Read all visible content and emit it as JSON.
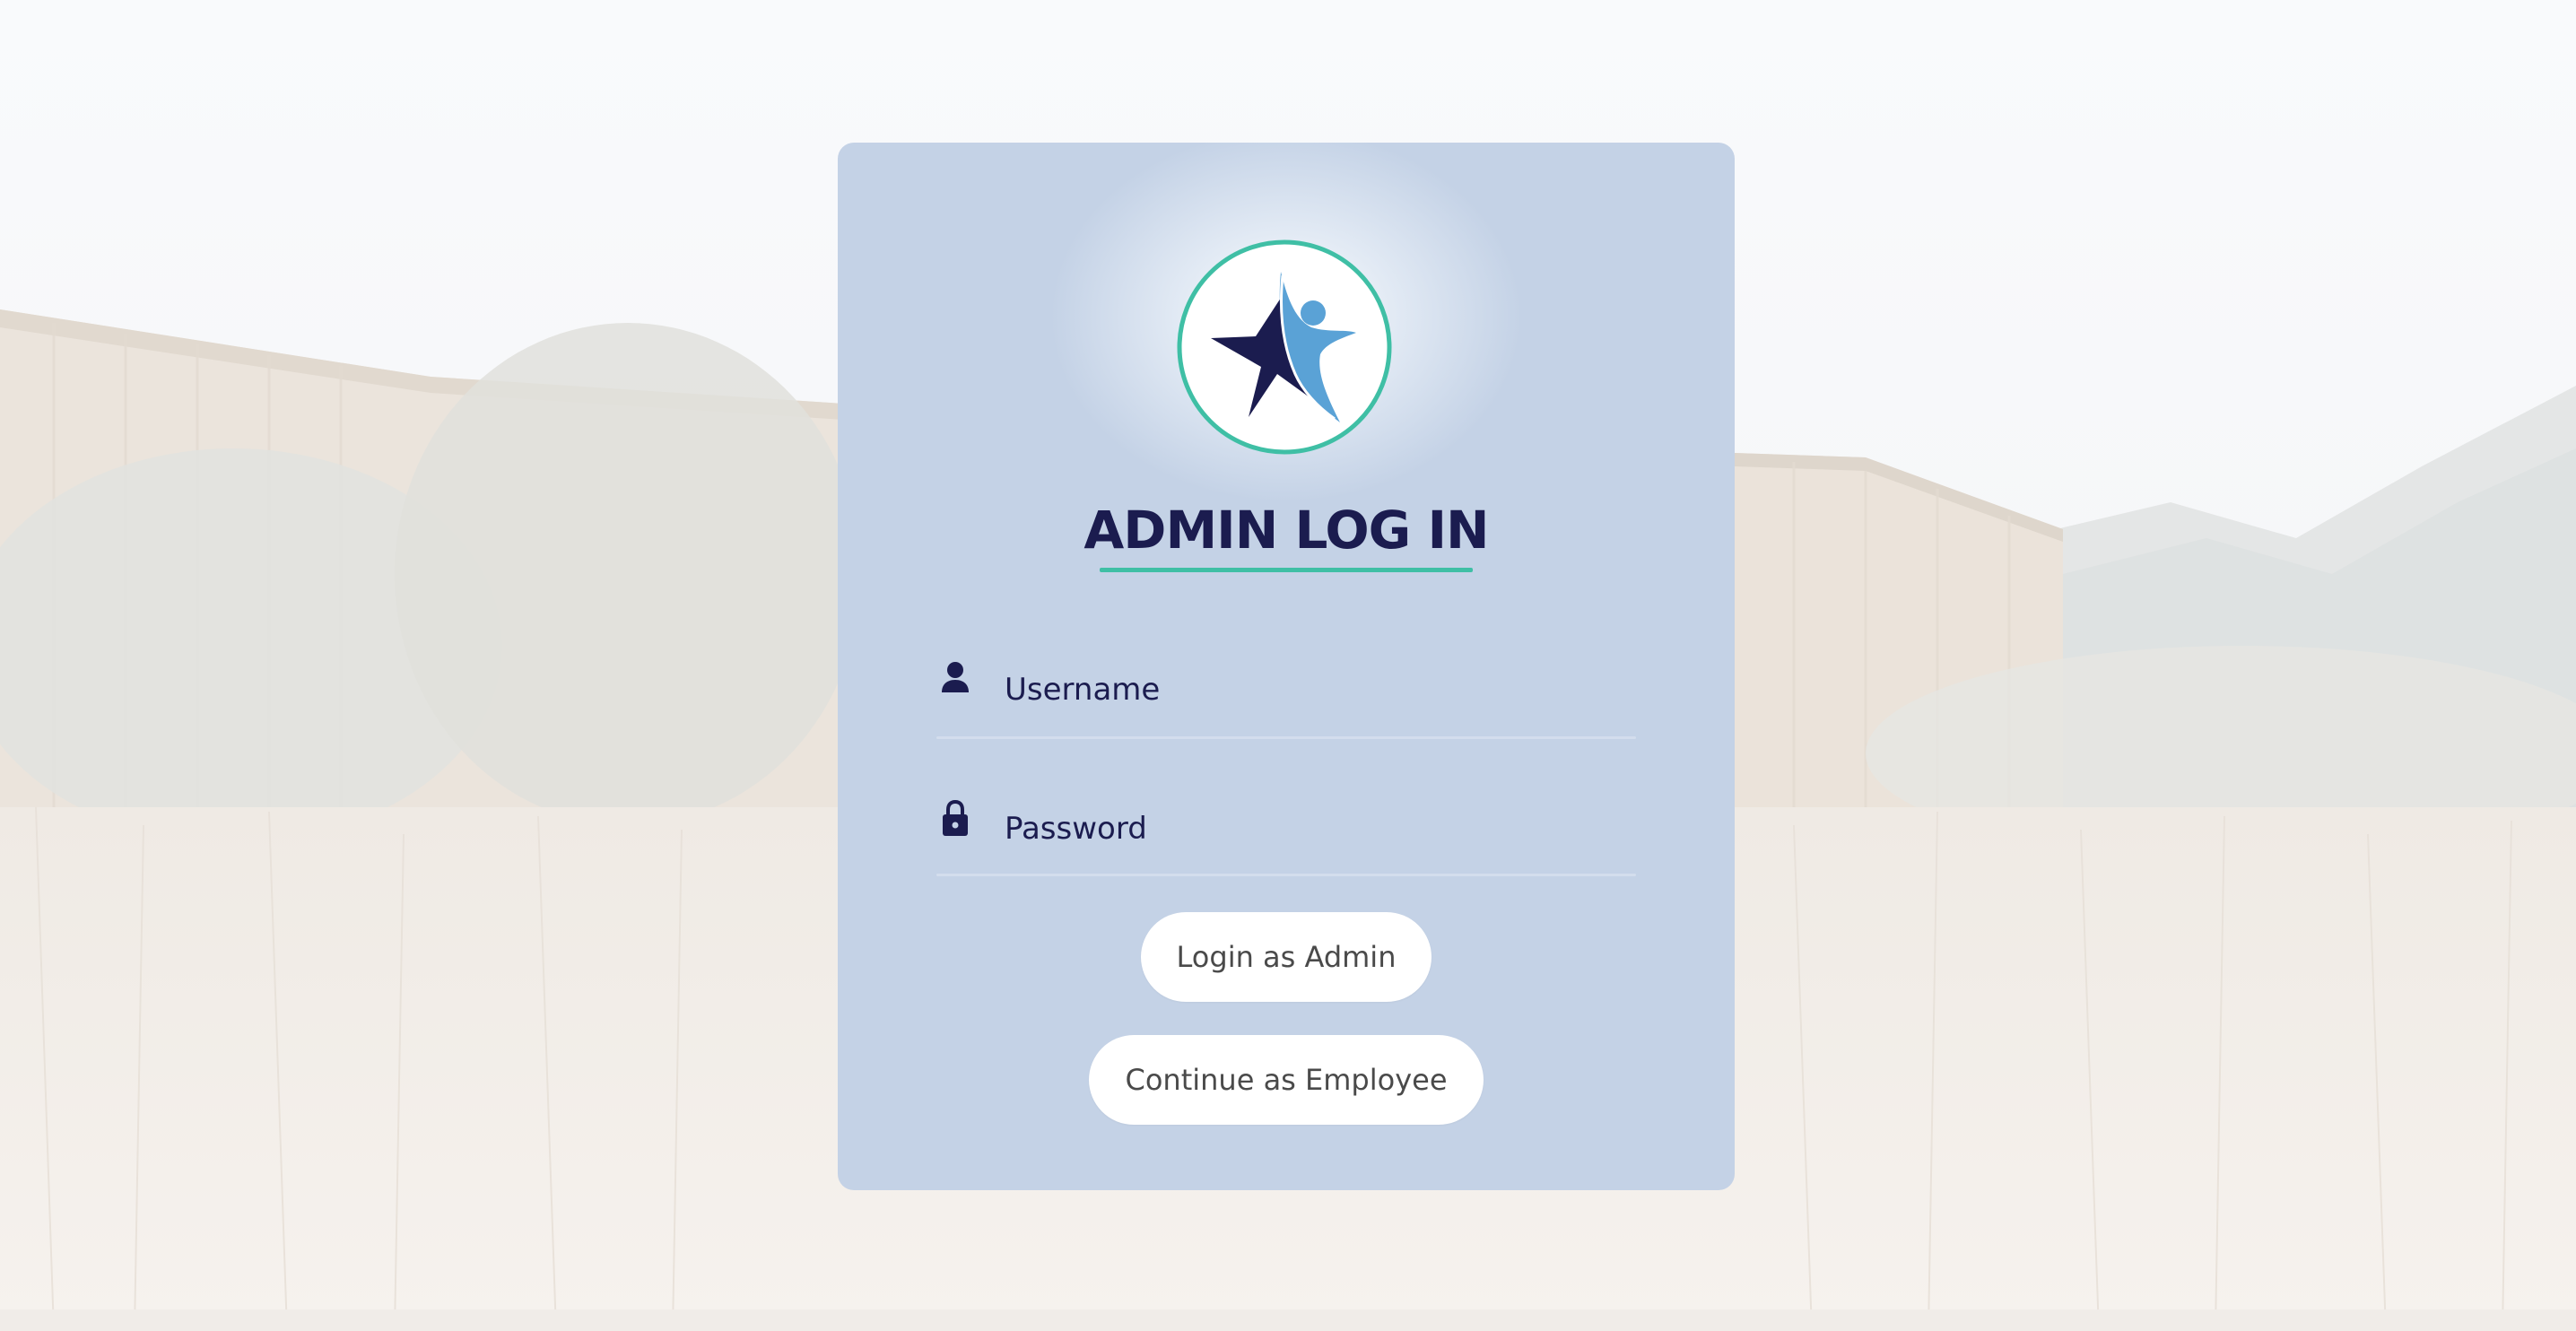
{
  "login": {
    "title": "ADMIN LOG IN",
    "username_placeholder": "Username",
    "password_placeholder": "Password",
    "admin_button": "Login as Admin",
    "employee_button": "Continue as Employee"
  },
  "icons": {
    "logo": "star-person-logo-icon",
    "username": "user-icon",
    "password": "lock-icon"
  },
  "colors": {
    "card": "#c4d2e6",
    "title": "#1b1c4f",
    "accent": "#3fbfa5",
    "logo_star": "#1b1c4f",
    "logo_person": "#5aa2d6",
    "button_bg": "#ffffff",
    "button_text": "#4a4a4a"
  }
}
